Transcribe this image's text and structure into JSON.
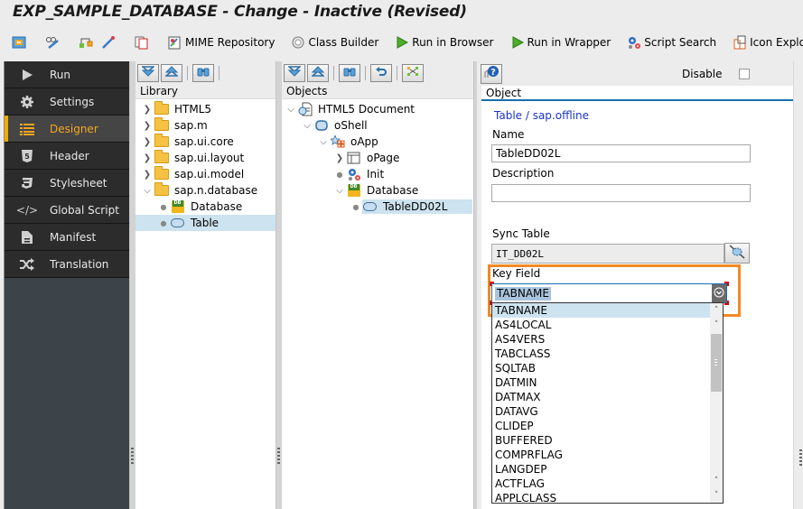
{
  "window": {
    "title": "EXP_SAMPLE_DATABASE - Change - Inactive (Revised)"
  },
  "toolbar": {
    "icons": [
      "toggle-display-change-icon",
      "glasses-pencil-icon",
      "hierarchy-icon",
      "magic-wand-icon",
      "copy-icon"
    ],
    "buttons": [
      {
        "label": "MIME Repository",
        "icon": "mime-repository-icon"
      },
      {
        "label": "Class Builder",
        "icon": "class-builder-icon"
      },
      {
        "label": "Run in Browser",
        "icon": "play-icon"
      },
      {
        "label": "Run in Wrapper",
        "icon": "play-icon"
      },
      {
        "label": "Script Search",
        "icon": "gears-icon"
      },
      {
        "label": "Icon Explorer",
        "icon": "icon-explorer-icon"
      }
    ]
  },
  "sidebar": {
    "active": "Designer",
    "items": [
      {
        "label": "Run",
        "icon": "play-icon"
      },
      {
        "label": "Settings",
        "icon": "gear-icon"
      },
      {
        "label": "Designer",
        "icon": "list-icon"
      },
      {
        "label": "Header",
        "icon": "html5-icon"
      },
      {
        "label": "Stylesheet",
        "icon": "css3-icon"
      },
      {
        "label": "Global Script",
        "icon": "code-icon"
      },
      {
        "label": "Manifest",
        "icon": "document-icon"
      },
      {
        "label": "Translation",
        "icon": "shuffle-icon"
      }
    ]
  },
  "library": {
    "header": "Library",
    "tools": [
      "expand-all-icon",
      "collapse-all-icon",
      "binoculars-icon"
    ],
    "items": [
      {
        "label": "HTML5",
        "type": "folder",
        "state": "collapsed"
      },
      {
        "label": "sap.m",
        "type": "folder",
        "state": "collapsed"
      },
      {
        "label": "sap.ui.core",
        "type": "folder",
        "state": "collapsed"
      },
      {
        "label": "sap.ui.layout",
        "type": "folder",
        "state": "collapsed"
      },
      {
        "label": "sap.ui.model",
        "type": "folder",
        "state": "collapsed"
      },
      {
        "label": "sap.n.database",
        "type": "folder",
        "state": "expanded"
      },
      {
        "label": "Database",
        "type": "database",
        "state": "leaf"
      },
      {
        "label": "Table",
        "type": "table",
        "state": "leaf",
        "selected": true
      }
    ]
  },
  "objects": {
    "header": "Objects",
    "tools": [
      "expand-all-icon",
      "collapse-all-icon",
      "binoculars-icon",
      "undo-icon",
      "layout-icon"
    ],
    "items": [
      {
        "label": "HTML5 Document",
        "type": "document",
        "state": "expanded"
      },
      {
        "label": "oShell",
        "type": "shell",
        "state": "expanded"
      },
      {
        "label": "oApp",
        "type": "app",
        "state": "expanded"
      },
      {
        "label": "oPage",
        "type": "page",
        "state": "collapsed"
      },
      {
        "label": "Init",
        "type": "script",
        "state": "leaf"
      },
      {
        "label": "Database",
        "type": "database",
        "state": "expanded"
      },
      {
        "label": "TableDD02L",
        "type": "table",
        "state": "leaf",
        "selected": true
      }
    ]
  },
  "properties": {
    "disable_label": "Disable",
    "disable_checked": false,
    "tab": "Object",
    "crumb": "Table / sap.offline",
    "name_label": "Name",
    "name_value": "TableDD02L",
    "description_label": "Description",
    "description_value": "",
    "sync_label": "Sync Table",
    "sync_value": "IT_DD02L",
    "key_label": "Key Field",
    "key_value": "TABNAME",
    "key_options": [
      "TABNAME",
      "AS4LOCAL",
      "AS4VERS",
      "TABCLASS",
      "SQLTAB",
      "DATMIN",
      "DATMAX",
      "DATAVG",
      "CLIDEP",
      "BUFFERED",
      "COMPRFLAG",
      "LANGDEP",
      "ACTFLAG",
      "APPLCLASS"
    ]
  }
}
